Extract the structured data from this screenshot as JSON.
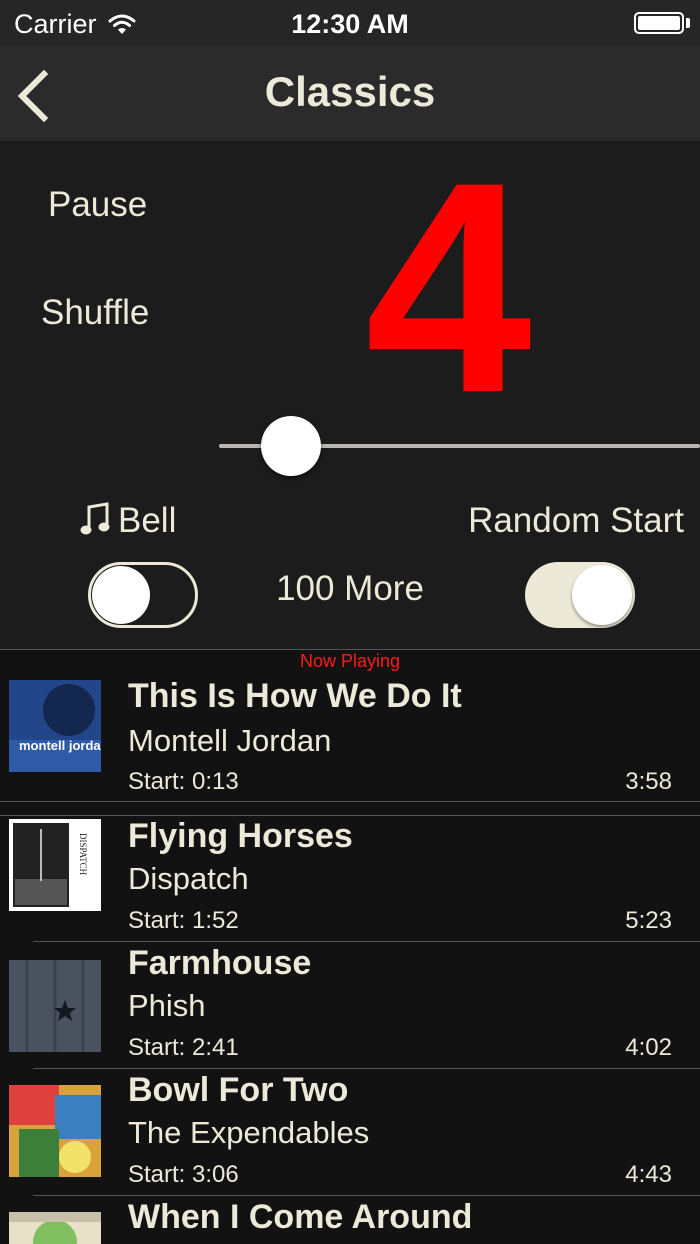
{
  "status_bar": {
    "carrier": "Carrier",
    "time": "12:30 AM"
  },
  "nav": {
    "title": "Classics",
    "back_icon": "chevron-left-icon"
  },
  "controls": {
    "pause": "Pause",
    "shuffle": "Shuffle",
    "count": "4",
    "count_color": "#ff0000",
    "slider_value_fraction": 0.05,
    "bell": "Bell",
    "bell_icon": "music-note-icon",
    "bell_enabled": false,
    "random_start": "Random Start",
    "random_start_enabled": true,
    "more": "100 More"
  },
  "list": {
    "now_playing": "Now Playing",
    "now_playing_color": "#ff1a1a",
    "songs": [
      {
        "title": "This Is How We Do It",
        "artist": "Montell Jordan",
        "start": "Start: 0:13",
        "duration": "3:58",
        "art_text": "montell jordan"
      },
      {
        "title": "Flying Horses",
        "artist": "Dispatch",
        "start": "Start: 1:52",
        "duration": "5:23",
        "art_text": "DISPATCH"
      },
      {
        "title": "Farmhouse",
        "artist": "Phish",
        "start": "Start: 2:41",
        "duration": "4:02"
      },
      {
        "title": "Bowl For Two",
        "artist": "The Expendables",
        "start": "Start: 3:06",
        "duration": "4:43"
      },
      {
        "title": "When I Come Around",
        "artist": "",
        "start": "",
        "duration": ""
      }
    ]
  }
}
